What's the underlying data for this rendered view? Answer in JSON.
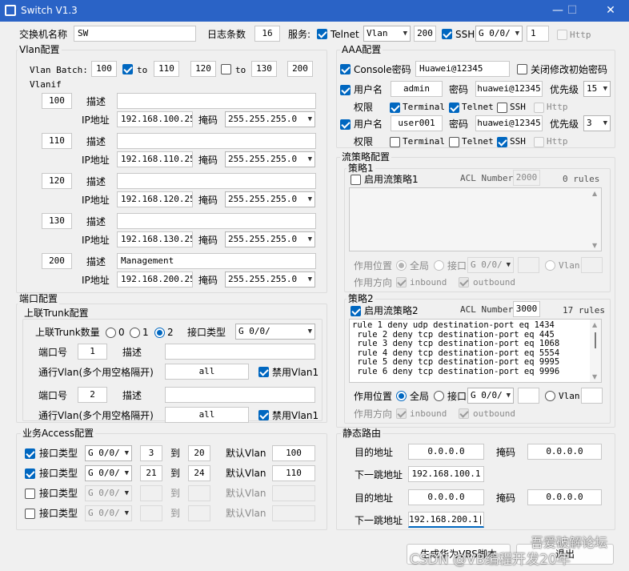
{
  "window": {
    "title": "Switch V1.3",
    "min": "—",
    "max": "☐",
    "close": "✕"
  },
  "top": {
    "hostname_label": "交换机名称",
    "hostname": "SW",
    "log_label": "日志条数",
    "log_count": "16",
    "service_label": "服务:",
    "telnet_label": "Telnet",
    "telnet_vlan": "Vlan",
    "telnet_vlan_id": "200",
    "ssh_label": "SSH",
    "ssh_port": "G 0/0/",
    "ssh_num": "1",
    "http_label": "Http"
  },
  "vlan": {
    "legend": "Vlan配置",
    "batch_label": "Vlan Batch:",
    "b1": "100",
    "b2": "110",
    "b3": "120",
    "b4": "130",
    "b5": "200",
    "to": "to",
    "vlanif_label": "Vlanif",
    "desc_label": "描述",
    "ip_label": "IP地址",
    "mask_label": "掩码",
    "items": [
      {
        "id": "100",
        "desc": "",
        "ip": "192.168.100.254",
        "mask": "255.255.255.0"
      },
      {
        "id": "110",
        "desc": "",
        "ip": "192.168.110.254",
        "mask": "255.255.255.0"
      },
      {
        "id": "120",
        "desc": "",
        "ip": "192.168.120.254",
        "mask": "255.255.255.0"
      },
      {
        "id": "130",
        "desc": "",
        "ip": "192.168.130.254",
        "mask": "255.255.255.0"
      },
      {
        "id": "200",
        "desc": "Management",
        "ip": "192.168.200.254",
        "mask": "255.255.255.0"
      }
    ]
  },
  "aaa": {
    "legend": "AAA配置",
    "console_label": "Console密码",
    "console_pwd": "Huawei@12345",
    "close_init_label": "关闭修改初始密码",
    "user_label": "用户名",
    "pwd_label": "密码",
    "priority_label": "优先级",
    "perm_label": "权限",
    "terminal": "Terminal",
    "telnet": "Telnet",
    "ssh": "SSH",
    "http": "Http",
    "users": [
      {
        "name": "admin",
        "pwd": "huawei@12345",
        "priority": "15"
      },
      {
        "name": "user001",
        "pwd": "huawei@12345",
        "priority": "3"
      }
    ]
  },
  "policy": {
    "legend": "流策略配置",
    "p1": {
      "legend": "策略1",
      "enable_label": "启用流策略1",
      "acl_label": "ACL Number",
      "acl": "2000",
      "rules": "0 rules",
      "apply_label": "作用位置",
      "global": "全局",
      "port": "接口",
      "port_val": "G 0/0/",
      "vlan": "Vlan",
      "dir_label": "作用方向",
      "inbound": "inbound",
      "outbound": "outbound"
    },
    "p2": {
      "legend": "策略2",
      "enable_label": "启用流策略2",
      "acl_label": "ACL Number",
      "acl": "3000",
      "rules": "17 rules",
      "apply_label": "作用位置",
      "global": "全局",
      "port": "接口",
      "port_val": "G 0/0/",
      "vlan": "Vlan",
      "dir_label": "作用方向",
      "inbound": "inbound",
      "outbound": "outbound",
      "lines": [
        "rule 1 deny udp destination-port eq 1434",
        " rule 2 deny tcp destination-port eq 445",
        " rule 3 deny tcp destination-port eq 1068",
        " rule 4 deny tcp destination-port eq 5554",
        " rule 5 deny tcp destination-port eq 9995",
        " rule 6 deny tcp destination-port eq 9996"
      ]
    }
  },
  "port": {
    "legend": "端口配置",
    "trunk_legend": "上联Trunk配置",
    "trunk_count_label": "上联Trunk数量",
    "r0": "0",
    "r1": "1",
    "r2": "2",
    "if_type_label": "接口类型",
    "if_type": "G 0/0/",
    "port_no_label": "端口号",
    "desc_label": "描述",
    "pass_label": "通行Vlan(多个用空格隔开)",
    "disable_vlan1": "禁用Vlan1",
    "trunks": [
      {
        "port": "1",
        "desc": "",
        "vlans": "all"
      },
      {
        "port": "2",
        "desc": "",
        "vlans": "all"
      }
    ],
    "access_legend": "业务Access配置",
    "acc_if_label": "接口类型",
    "to_label": "到",
    "def_vlan_label": "默认Vlan",
    "access": [
      {
        "type": "G 0/0/",
        "from": "3",
        "to": "20",
        "vlan": "100"
      },
      {
        "type": "G 0/0/",
        "from": "21",
        "to": "24",
        "vlan": "110"
      },
      {
        "type": "G 0/0/",
        "from": "",
        "to": "",
        "vlan": ""
      },
      {
        "type": "G 0/0/",
        "from": "",
        "to": "",
        "vlan": ""
      }
    ]
  },
  "route": {
    "legend": "静态路由",
    "dest_label": "目的地址",
    "mask_label": "掩码",
    "next_label": "下一跳地址",
    "routes": [
      {
        "dest": "0.0.0.0",
        "mask": "0.0.0.0",
        "next": "192.168.100.1"
      },
      {
        "dest": "0.0.0.0",
        "mask": "0.0.0.0",
        "next": "192.168.200.1|"
      }
    ]
  },
  "buttons": {
    "generate": "生成华为VBS脚本",
    "exit": "退出"
  },
  "watermark": {
    "line1": "吾爱破解论坛",
    "line2": "CSDN @VB编程开发20年"
  }
}
